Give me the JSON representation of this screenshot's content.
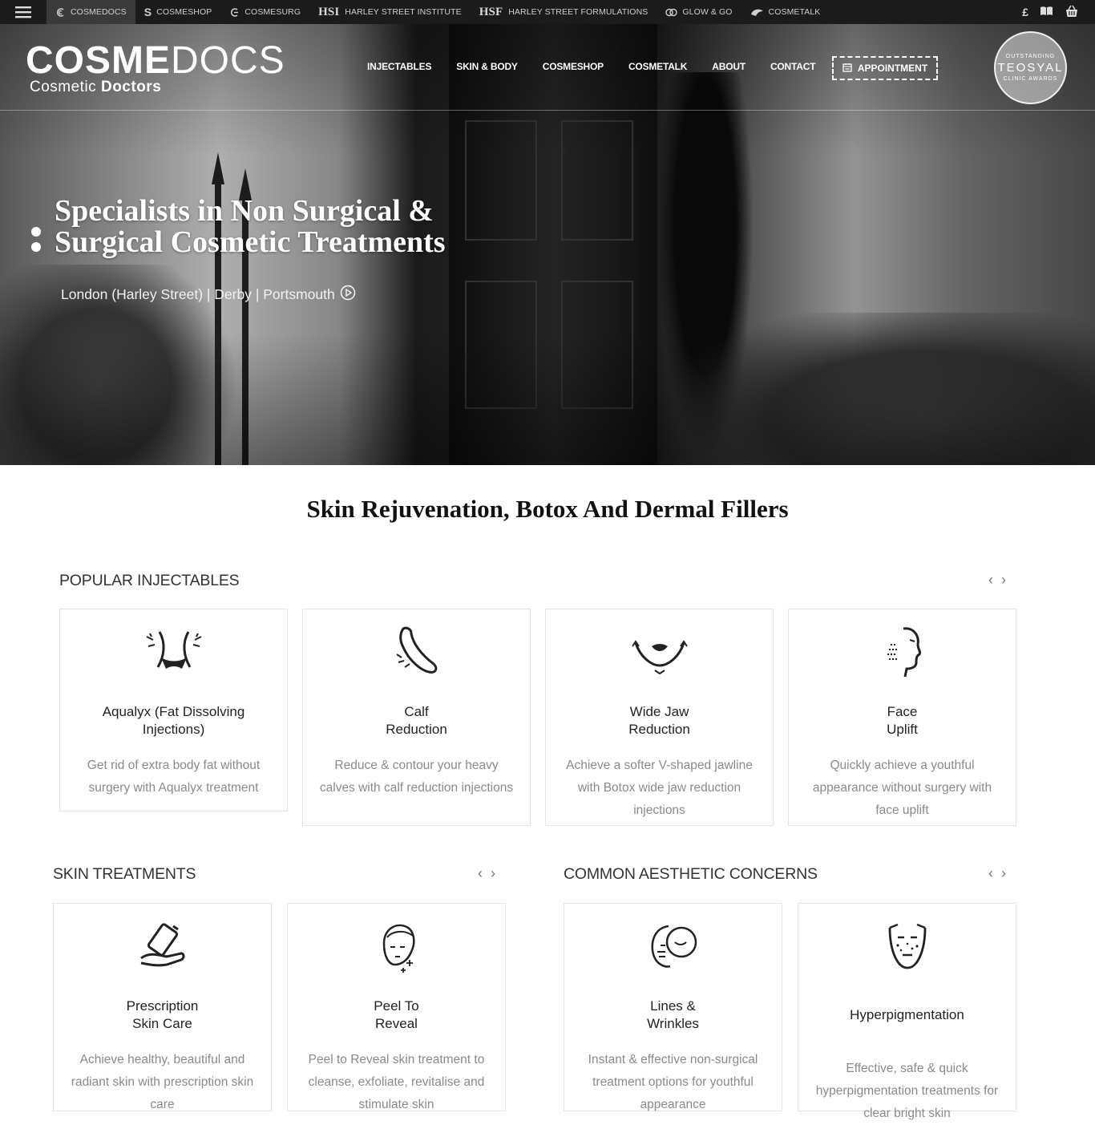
{
  "topbar": {
    "brands": [
      {
        "label": "COSMEDOCS",
        "mark": ""
      },
      {
        "label": "COSMESHOP",
        "mark": ""
      },
      {
        "label": "COSMESURG",
        "mark": ""
      },
      {
        "label": "HARLEY STREET INSTITUTE",
        "mark": "HSI"
      },
      {
        "label": "HARLEY STREET FORMULATIONS",
        "mark": "HSF"
      },
      {
        "label": "GLOW & GO",
        "mark": ""
      },
      {
        "label": "COSMETALK",
        "mark": ""
      }
    ],
    "currency": "£"
  },
  "header": {
    "logo_bold": "COSME",
    "logo_light": "DOCS",
    "logo_sub_a": "Cosmetic ",
    "logo_sub_b": "Doctors",
    "nav": [
      "INJECTABLES",
      "SKIN & BODY",
      "COSMESHOP",
      "COSMETALK",
      "ABOUT",
      "CONTACT"
    ],
    "appointment": "APPOINTMENT",
    "award": {
      "top": "OUTSTANDING",
      "mid": "TEOSYAL",
      "bot": "CLINIC AWARDS"
    }
  },
  "hero": {
    "title_line1": "Specialists in Non Surgical &",
    "title_line2": "Surgical Cosmetic Treatments",
    "locations": "London (Harley Street) | Derby | Portsmouth"
  },
  "main": {
    "title": "Skin Rejuvenation, Botox And Dermal Fillers",
    "popular": {
      "heading": "POPULAR INJECTABLES",
      "cards": [
        {
          "title1": "Aqualyx (Fat Dissolving",
          "title2": "Injections)",
          "desc": "Get rid of extra body fat without surgery with Aqualyx treatment",
          "icon": "waist-icon"
        },
        {
          "title1": "Calf",
          "title2": "Reduction",
          "desc": "Reduce & contour your heavy calves with calf reduction injections",
          "icon": "calf-icon"
        },
        {
          "title1": "Wide Jaw",
          "title2": "Reduction",
          "desc": "Achieve a softer V-shaped jawline with Botox wide jaw reduction injections",
          "icon": "jaw-icon"
        },
        {
          "title1": "Face",
          "title2": "Uplift",
          "desc": "Quickly achieve a youthful appearance without surgery with face uplift",
          "icon": "face-profile-icon"
        }
      ]
    },
    "skin": {
      "heading": "SKIN TREATMENTS",
      "cards": [
        {
          "title1": "Prescription",
          "title2": "Skin Care",
          "desc": "Achieve healthy, beautiful and radiant skin with prescription skin care",
          "icon": "skincare-icon"
        },
        {
          "title1": "Peel To",
          "title2": "Reveal",
          "desc": "Peel to Reveal skin treatment to cleanse, exfoliate, revitalise and stimulate skin",
          "icon": "peel-face-icon"
        }
      ]
    },
    "concerns": {
      "heading": "COMMON AESTHETIC CONCERNS",
      "cards": [
        {
          "title1": "Lines &",
          "title2": "Wrinkles",
          "desc": "Instant & effective non-surgical treatment options for youthful appearance",
          "icon": "wrinkles-icon"
        },
        {
          "title1": "Hyperpigmentation",
          "title2": "",
          "desc": "Effective, safe & quick hyperpigmentation treatments for clear bright skin",
          "icon": "pigment-face-icon"
        }
      ]
    }
  }
}
